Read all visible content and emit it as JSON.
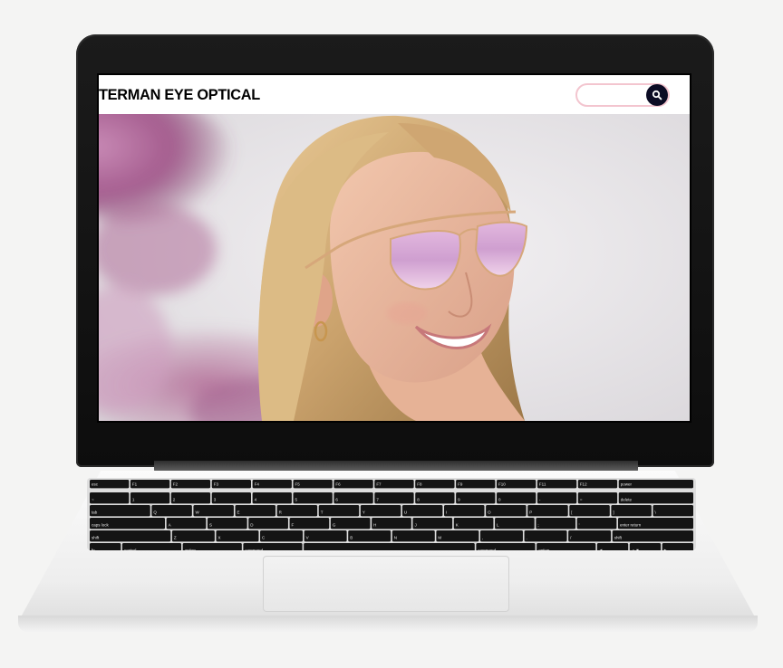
{
  "site": {
    "brand": "TERMAN EYE OPTICAL"
  },
  "search": {
    "value": "",
    "placeholder": "",
    "button_icon": "search-icon"
  },
  "hero": {
    "image": "woman-with-pink-mirrored-aviator-sunglasses"
  },
  "keyboard": {
    "keys": [
      [
        "esc",
        "F1",
        "F2",
        "F3",
        "F4",
        "F5",
        "F6",
        "F7",
        "F8",
        "F9",
        "F10",
        "F11",
        "F12",
        "power"
      ],
      [
        "~",
        "1",
        "2",
        "3",
        "4",
        "5",
        "6",
        "7",
        "8",
        "9",
        "0",
        "-",
        "=",
        "delete"
      ],
      [
        "tab",
        "Q",
        "W",
        "E",
        "R",
        "T",
        "Y",
        "U",
        "I",
        "O",
        "P",
        "[",
        "]",
        "\\"
      ],
      [
        "caps lock",
        "A",
        "S",
        "D",
        "F",
        "G",
        "H",
        "J",
        "K",
        "L",
        ";",
        "'",
        "enter return"
      ],
      [
        "shift",
        "Z",
        "X",
        "C",
        "V",
        "B",
        "N",
        "M",
        ",",
        ".",
        "/",
        "shift"
      ],
      [
        "fn",
        "control",
        "option",
        "command",
        "",
        "command",
        "option",
        "◀",
        "▲▼",
        "▶"
      ]
    ]
  },
  "colors": {
    "search_border": "#f3c5cf",
    "search_button": "#0c0c24",
    "lens_pink": "#d9a8d0",
    "frame_gold": "#d6a77a"
  }
}
